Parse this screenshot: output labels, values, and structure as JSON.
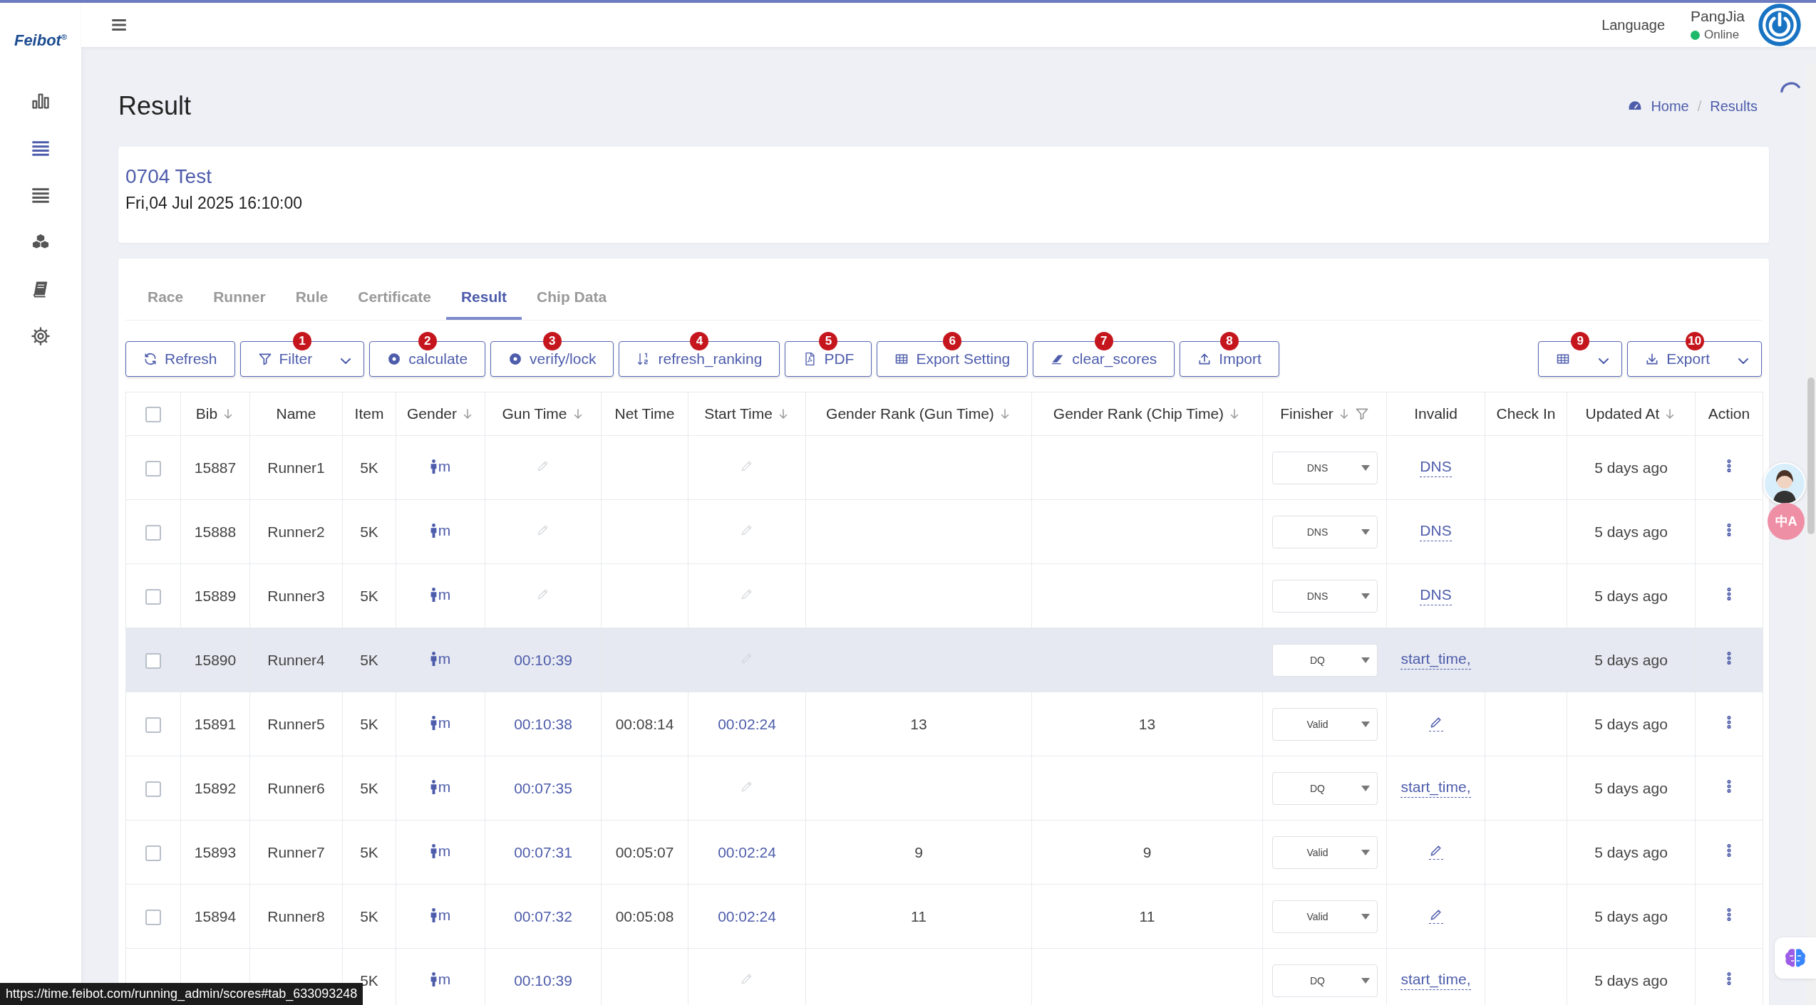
{
  "sidebar": {
    "logo": "Feibot$^{®}$",
    "items": [
      {
        "selected": false
      },
      {
        "selected": true
      },
      {
        "selected": false
      },
      {
        "selected": false
      },
      {
        "selected": false
      },
      {
        "selected": false
      }
    ]
  },
  "header": {
    "language": "Language",
    "user": {
      "name": "PangJia",
      "status": "Online"
    }
  },
  "page": {
    "title": "Result",
    "breadcrumb_separator": "/",
    "breadcrumb": [
      {
        "label": "Home"
      },
      {
        "label": "Results"
      }
    ]
  },
  "event": {
    "name": "0704 Test",
    "date": "Fri,04 Jul 2025 16:10:00"
  },
  "tabs": [
    {
      "label": "Race",
      "selected": false
    },
    {
      "label": "Runner",
      "selected": false
    },
    {
      "label": "Rule",
      "selected": false
    },
    {
      "label": "Certificate",
      "selected": false
    },
    {
      "label": "Result",
      "selected": true
    },
    {
      "label": "Chip Data",
      "selected": false
    }
  ],
  "toolbar": {
    "left": [
      {
        "label": "Refresh",
        "has_menu": false
      },
      {
        "label": "Filter",
        "badge": "1",
        "has_menu": true
      },
      {
        "label": "calculate",
        "badge": "2",
        "has_menu": false
      },
      {
        "label": "verify/lock",
        "badge": "3",
        "has_menu": false
      },
      {
        "label": "refresh_ranking",
        "badge": "4",
        "has_menu": false
      },
      {
        "label": "PDF",
        "badge": "5",
        "has_menu": false
      },
      {
        "label": "Export Setting",
        "badge": "6",
        "has_menu": false
      },
      {
        "label": "clear_scores",
        "badge": "7",
        "has_menu": false
      },
      {
        "label": "Import",
        "badge": "8",
        "has_menu": false
      }
    ],
    "right": [
      {
        "badge": "9",
        "has_menu": true
      },
      {
        "label": "Export",
        "badge": "10",
        "has_menu": true
      }
    ]
  },
  "table": {
    "select_all": {
      "checked": false
    },
    "columns": [
      {
        "label": "Bib",
        "sortable": true,
        "filterable": false
      },
      {
        "label": "Name",
        "sortable": false,
        "filterable": false
      },
      {
        "label": "Item",
        "sortable": false,
        "filterable": false
      },
      {
        "label": "Gender",
        "sortable": true,
        "filterable": false
      },
      {
        "label": "Gun Time",
        "sortable": true,
        "filterable": false
      },
      {
        "label": "Net Time",
        "sortable": false,
        "filterable": false
      },
      {
        "label": "Start Time",
        "sortable": true,
        "filterable": false
      },
      {
        "label": "Gender Rank (Gun Time)",
        "sortable": true,
        "filterable": false
      },
      {
        "label": "Gender Rank (Chip Time)",
        "sortable": true,
        "filterable": false
      },
      {
        "label": "Finisher",
        "sortable": true,
        "filterable": true
      },
      {
        "label": "Invalid",
        "sortable": false,
        "filterable": false
      },
      {
        "label": "Check In",
        "sortable": false,
        "filterable": false
      },
      {
        "label": "Updated At",
        "sortable": true,
        "filterable": false
      },
      {
        "label": "Action",
        "sortable": false,
        "filterable": false
      }
    ],
    "rows": [
      {
        "checked": false,
        "hovered": false,
        "bib": "15887",
        "name": "Runner1",
        "item": "5K",
        "gender": "m",
        "finisher": "DNS",
        "invalid": "DNS",
        "updated_at": "5 days ago"
      },
      {
        "checked": false,
        "hovered": false,
        "bib": "15888",
        "name": "Runner2",
        "item": "5K",
        "gender": "m",
        "finisher": "DNS",
        "invalid": "DNS",
        "updated_at": "5 days ago"
      },
      {
        "checked": false,
        "hovered": false,
        "bib": "15889",
        "name": "Runner3",
        "item": "5K",
        "gender": "m",
        "finisher": "DNS",
        "invalid": "DNS",
        "updated_at": "5 days ago"
      },
      {
        "checked": false,
        "hovered": true,
        "bib": "15890",
        "name": "Runner4",
        "item": "5K",
        "gender": "m",
        "gun_time": "00:10:39",
        "finisher": "DQ",
        "invalid": "start_time,",
        "updated_at": "5 days ago"
      },
      {
        "checked": false,
        "hovered": false,
        "bib": "15891",
        "name": "Runner5",
        "item": "5K",
        "gender": "m",
        "gun_time": "00:10:38",
        "net_time": "00:08:14",
        "start_time": "00:02:24",
        "rank_gun": "13",
        "rank_chip": "13",
        "finisher": "Valid",
        "updated_at": "5 days ago"
      },
      {
        "checked": false,
        "hovered": false,
        "bib": "15892",
        "name": "Runner6",
        "item": "5K",
        "gender": "m",
        "gun_time": "00:07:35",
        "finisher": "DQ",
        "invalid": "start_time,",
        "updated_at": "5 days ago"
      },
      {
        "checked": false,
        "hovered": false,
        "bib": "15893",
        "name": "Runner7",
        "item": "5K",
        "gender": "m",
        "gun_time": "00:07:31",
        "net_time": "00:05:07",
        "start_time": "00:02:24",
        "rank_gun": "9",
        "rank_chip": "9",
        "finisher": "Valid",
        "updated_at": "5 days ago"
      },
      {
        "checked": false,
        "hovered": false,
        "bib": "15894",
        "name": "Runner8",
        "item": "5K",
        "gender": "m",
        "gun_time": "00:07:32",
        "net_time": "00:05:08",
        "start_time": "00:02:24",
        "rank_gun": "11",
        "rank_chip": "11",
        "finisher": "Valid",
        "updated_at": "5 days ago"
      },
      {
        "hovered": false,
        "item": "5K",
        "gender": "m",
        "gun_time": "00:10:39",
        "finisher": "DQ",
        "invalid": "start_time,",
        "updated_at": "5 days ago"
      }
    ]
  },
  "translate_button": {
    "label": "中A"
  },
  "status_url": "https://time.feibot.com/running_admin/scores#tab_633093248"
}
